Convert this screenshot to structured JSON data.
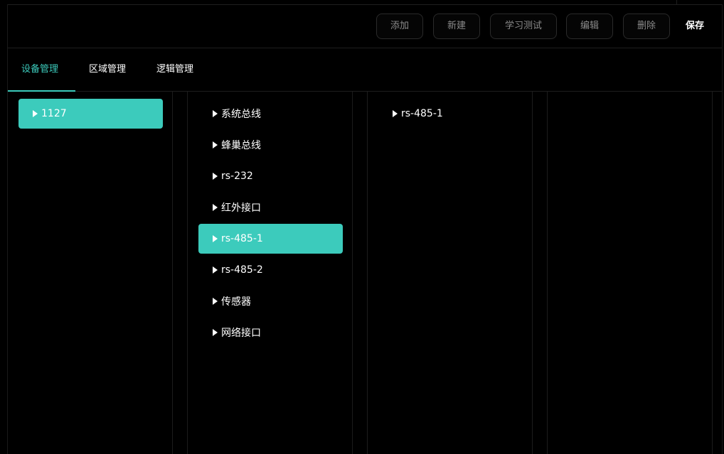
{
  "toolbar": {
    "buttons": [
      "添加",
      "新建",
      "学习测试",
      "编辑",
      "删除"
    ],
    "save_label": "保存"
  },
  "tabs": [
    "设备管理",
    "区域管理",
    "逻辑管理"
  ],
  "columns": {
    "devices": [
      "1127"
    ],
    "interfaces": [
      "系统总线",
      "蜂巢总线",
      "rs-232",
      "红外接口",
      "rs-485-1",
      "rs-485-2",
      "传感器",
      "网络接口"
    ],
    "children": [
      "rs-485-1"
    ]
  },
  "selected": {
    "device": "1127",
    "interface": "rs-485-1"
  },
  "colors": {
    "accent": "#3ccbbc",
    "background": "#000000",
    "border": "#2a2a2a"
  }
}
